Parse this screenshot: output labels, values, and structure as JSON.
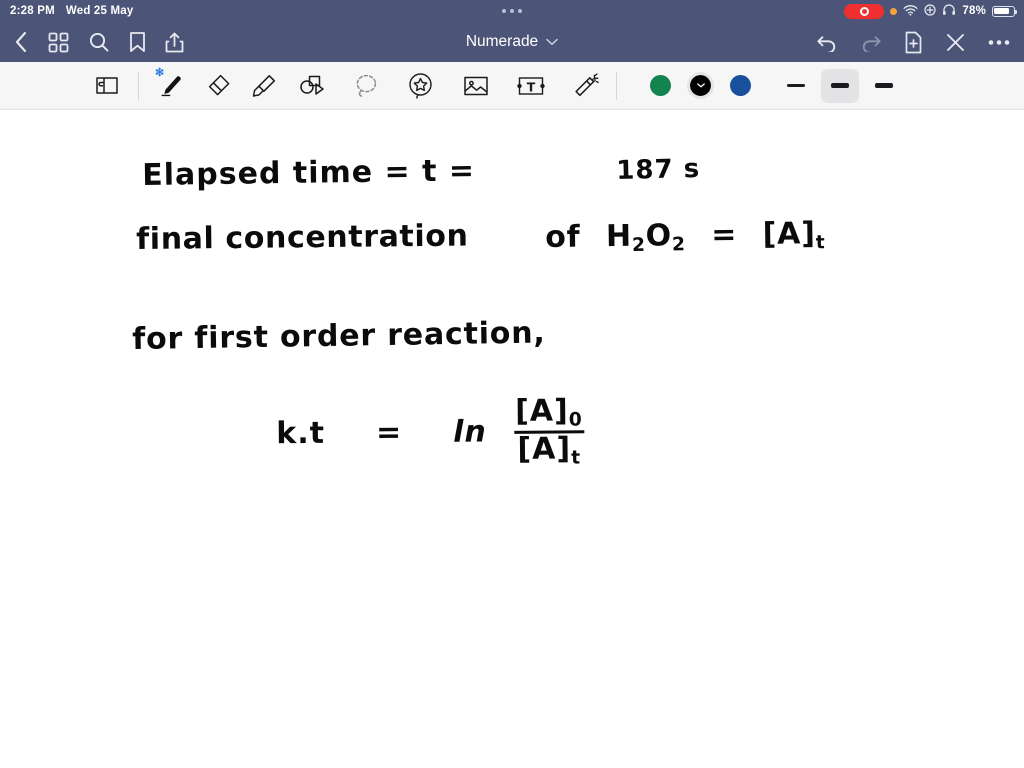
{
  "status_bar": {
    "time": "2:28 PM",
    "date": "Wed 25 May",
    "battery_percent": "78%",
    "icons": {
      "screen_recording": "record-pill-icon",
      "privacy": "orange-privacy-dot-icon",
      "wifi": "wifi-icon",
      "control": "control-center-icon",
      "headphones": "headphones-icon",
      "battery": "battery-icon",
      "multitask": "multitask-handle-icon"
    }
  },
  "nav_bar": {
    "title": "Numerade",
    "title_chevron": "chevron-down-icon",
    "left_buttons": [
      {
        "name": "back-button",
        "icon": "chevron-left-icon"
      },
      {
        "name": "thumbnails-button",
        "icon": "grid-icon"
      },
      {
        "name": "search-button",
        "icon": "search-icon"
      },
      {
        "name": "bookmark-button",
        "icon": "bookmark-icon"
      },
      {
        "name": "share-button",
        "icon": "share-icon"
      }
    ],
    "right_buttons": [
      {
        "name": "undo-button",
        "icon": "undo-icon",
        "enabled": true
      },
      {
        "name": "redo-button",
        "icon": "redo-icon",
        "enabled": false
      },
      {
        "name": "add-page-button",
        "icon": "document-plus-icon",
        "enabled": true
      },
      {
        "name": "close-button",
        "icon": "close-icon",
        "enabled": true
      },
      {
        "name": "more-button",
        "icon": "ellipsis-icon",
        "enabled": true
      }
    ]
  },
  "toolbar": {
    "tools": [
      {
        "name": "page-view-tool",
        "icon": "page-flip-icon",
        "selected": false
      },
      {
        "name": "pen-tool",
        "icon": "pen-icon",
        "selected": true,
        "badge": "bluetooth-icon"
      },
      {
        "name": "eraser-tool",
        "icon": "eraser-icon",
        "selected": false
      },
      {
        "name": "highlighter-tool",
        "icon": "highlighter-icon",
        "selected": false
      },
      {
        "name": "shapes-tool",
        "icon": "shapes-icon",
        "selected": false
      },
      {
        "name": "lasso-tool",
        "icon": "lasso-icon",
        "selected": false
      },
      {
        "name": "sticker-tool",
        "icon": "sticker-star-icon",
        "selected": false
      },
      {
        "name": "image-tool",
        "icon": "image-icon",
        "selected": false
      },
      {
        "name": "text-tool",
        "icon": "text-box-icon",
        "selected": false
      },
      {
        "name": "magic-wand-tool",
        "icon": "magic-wand-icon",
        "selected": false
      }
    ],
    "colors": [
      {
        "name": "color-swatch-green",
        "hex": "#13834f",
        "selected": false
      },
      {
        "name": "color-swatch-black",
        "hex": "#000000",
        "selected": true
      },
      {
        "name": "color-swatch-blue",
        "hex": "#18509b",
        "selected": false
      }
    ],
    "stroke_widths": [
      {
        "name": "stroke-width-thin",
        "selected": false
      },
      {
        "name": "stroke-width-medium",
        "selected": true
      },
      {
        "name": "stroke-width-thick",
        "selected": false
      }
    ]
  },
  "canvas": {
    "notes": [
      {
        "id": "line-elapsed-time",
        "text": "Elapsed  time   =  t  ="
      },
      {
        "id": "line-elapsed-value",
        "text": "187 s"
      },
      {
        "id": "line-final-concentration",
        "text": "final  concentration"
      },
      {
        "id": "line-h2o2",
        "text_parts": {
          "of": "of",
          "formula_h": "H",
          "formula_sub2a": "2",
          "formula_o": "O",
          "formula_sub2b": "2",
          "equals": "=",
          "bracket_a": "[A]",
          "sub_t": "t"
        }
      },
      {
        "id": "line-first-order",
        "text": "for  first  order  reaction,"
      },
      {
        "id": "line-kt-equation",
        "text_parts": {
          "kt": "k.t",
          "equals": "=",
          "ln": "ln",
          "numerator": "[A]",
          "numerator_sub": "0",
          "denominator": "[A]",
          "denominator_sub": "t"
        }
      }
    ]
  }
}
